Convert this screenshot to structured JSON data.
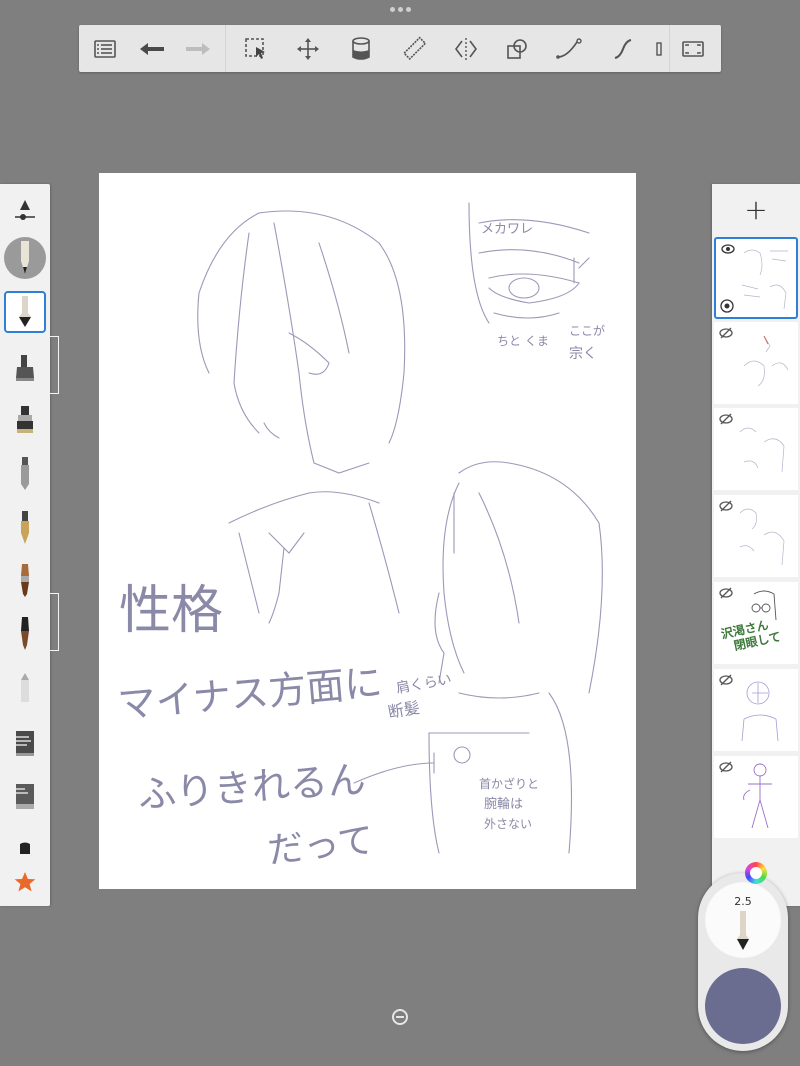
{
  "app": "SketchBook",
  "toolbar": {
    "buttons": [
      "layers-list",
      "undo",
      "redo",
      "select",
      "transform",
      "fill",
      "ruler",
      "symmetry",
      "shapes",
      "line",
      "curve",
      "more",
      "fullscreen"
    ]
  },
  "brush_palette": {
    "tools": [
      "brush-settings",
      "pencil-large",
      "pencil",
      "airbrush",
      "marker",
      "ballpoint",
      "fountain-pen",
      "paint-brush",
      "ink-brush",
      "eraser",
      "hard-brush",
      "smudge",
      "blob",
      "favorite-star"
    ],
    "selected": "pencil"
  },
  "layers": {
    "add_label": "+",
    "items": [
      {
        "visible": true,
        "selected": true
      },
      {
        "visible": false
      },
      {
        "visible": false
      },
      {
        "visible": false
      },
      {
        "visible": false
      },
      {
        "visible": false
      },
      {
        "visible": false
      }
    ]
  },
  "brush_widget": {
    "size": "2.5",
    "color": "#6b6d90"
  },
  "canvas": {
    "text": {
      "megane": "メカワレ",
      "chotokuma": "ちと くま",
      "kokoga": "ここが",
      "usuku": "宗く",
      "seikaku": "性格",
      "minus": "マイナス方面に",
      "furikireru": "ふりきれるん",
      "datte": "だって",
      "katakurai": "肩くらい",
      "danpatsu": "断髪",
      "kubikazari": "首かざりと",
      "wansho": "腕輪は",
      "hazusanai": "外さない"
    },
    "layer_thumb_text": {
      "sawamura": "沢渇さん",
      "heimoku": "閉眼して"
    }
  }
}
